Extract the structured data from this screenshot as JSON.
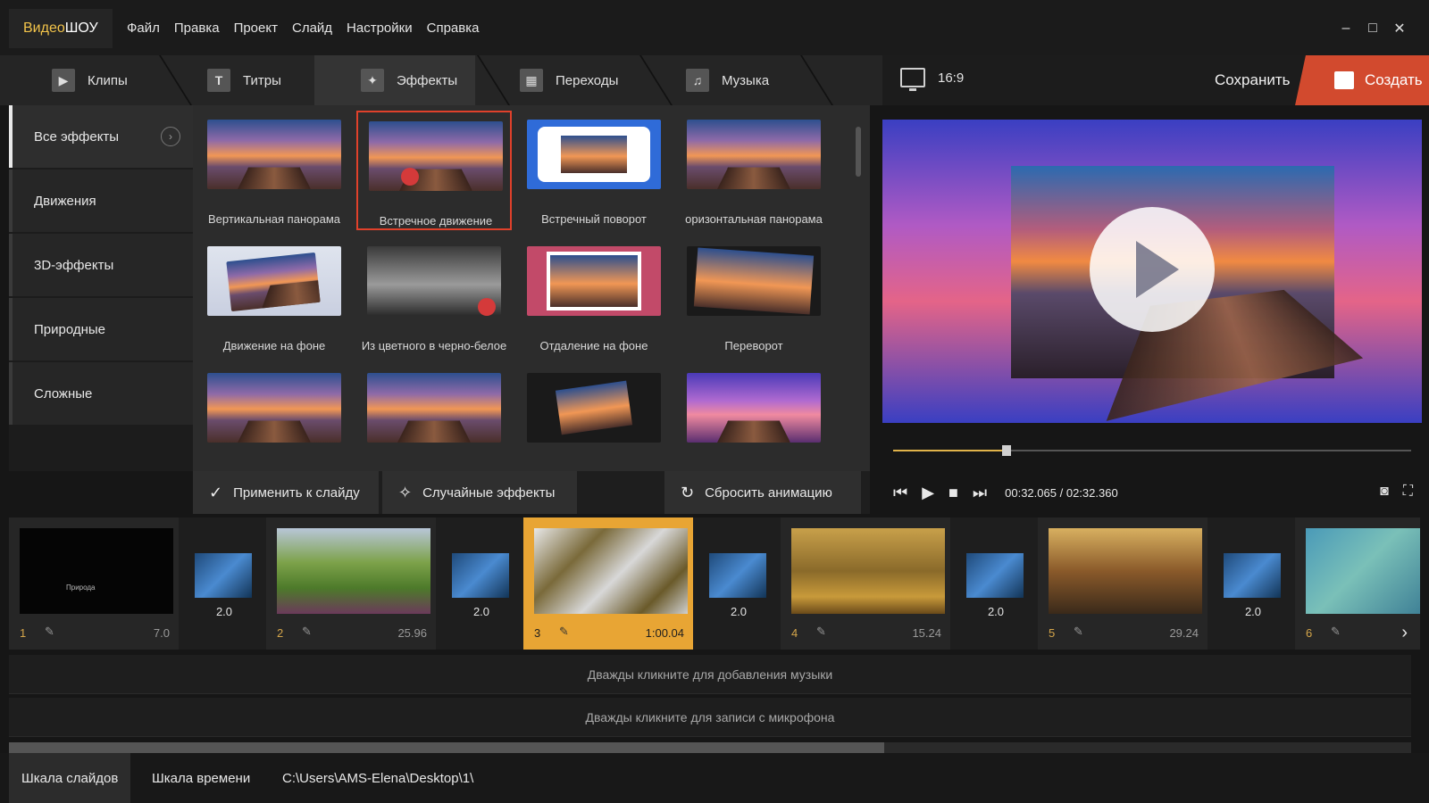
{
  "app": {
    "logo_part1": "Видео",
    "logo_part2": "ШОУ"
  },
  "menu": [
    "Файл",
    "Правка",
    "Проект",
    "Слайд",
    "Настройки",
    "Справка"
  ],
  "window_controls": {
    "minimize": "–",
    "maximize": "□",
    "close": "✕"
  },
  "tabs": [
    {
      "label": "Клипы",
      "icon": "play-icon"
    },
    {
      "label": "Титры",
      "icon": "text-icon"
    },
    {
      "label": "Эффекты",
      "icon": "magic-wand-icon",
      "active": true
    },
    {
      "label": "Переходы",
      "icon": "transition-icon"
    },
    {
      "label": "Музыка",
      "icon": "music-icon"
    }
  ],
  "toolbar": {
    "ratio": "16:9",
    "save_label": "Сохранить",
    "create_label": "Создать"
  },
  "sidebar": {
    "items": [
      {
        "label": "Все эффекты",
        "active": true
      },
      {
        "label": "Движения"
      },
      {
        "label": "3D-эффекты"
      },
      {
        "label": "Природные"
      },
      {
        "label": "Сложные"
      }
    ]
  },
  "effects": [
    {
      "label": "Вертикальная панорама"
    },
    {
      "label": "Встречное движение",
      "selected": true
    },
    {
      "label": "Встречный поворот"
    },
    {
      "label": "оризонтальная панорама"
    },
    {
      "label": "Движение на фоне"
    },
    {
      "label": "Из цветного в черно-белое"
    },
    {
      "label": "Отдаление на фоне"
    },
    {
      "label": "Переворот"
    },
    {
      "label": ""
    },
    {
      "label": ""
    },
    {
      "label": ""
    },
    {
      "label": ""
    }
  ],
  "actions": {
    "apply": "Применить к слайду",
    "random": "Случайные эффекты",
    "reset": "Сбросить анимацию"
  },
  "player": {
    "current_time": "00:32.065",
    "separator": "/",
    "total_time": "02:32.360",
    "progress": 0.21
  },
  "slides": [
    {
      "num": "1",
      "duration": "7.0",
      "caption": "Природа"
    },
    {
      "num": "2",
      "duration": "25.96"
    },
    {
      "num": "3",
      "duration": "1:00.04",
      "active": true
    },
    {
      "num": "4",
      "duration": "15.24"
    },
    {
      "num": "5",
      "duration": "29.24"
    },
    {
      "num": "6",
      "duration": ""
    }
  ],
  "transitions": [
    "2.0",
    "2.0",
    "2.0",
    "2.0",
    "2.0"
  ],
  "audio": {
    "music_hint": "Дважды кликните для добавления музыки",
    "mic_hint": "Дважды кликните для записи с микрофона"
  },
  "status": {
    "slides_tab": "Шкала слайдов",
    "timeline_tab": "Шкала времени",
    "path": "C:\\Users\\AMS-Elena\\Desktop\\1\\"
  }
}
